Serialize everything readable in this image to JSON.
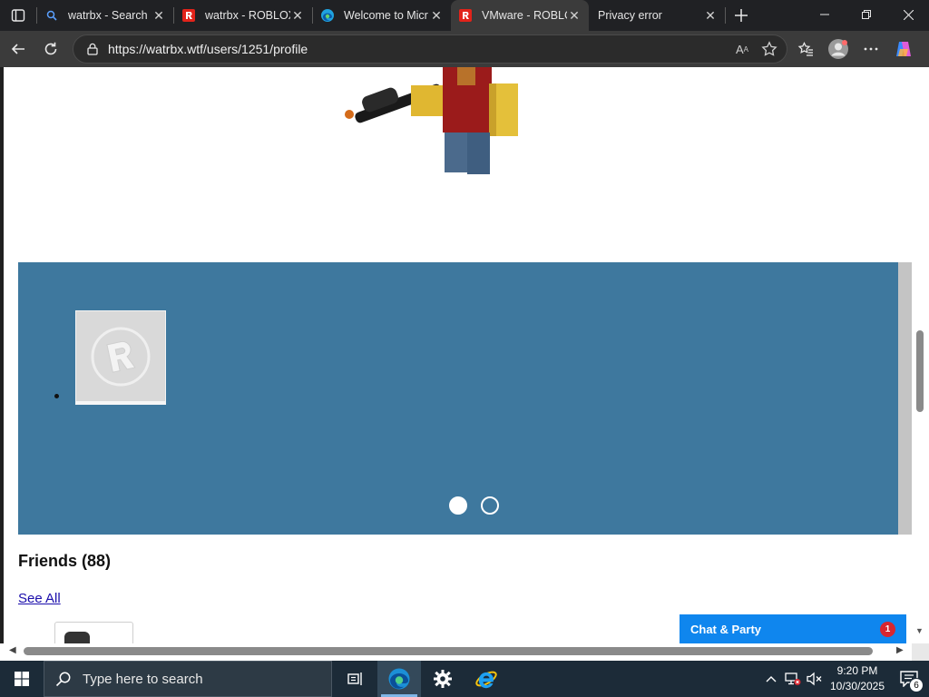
{
  "browser": {
    "tabs": [
      {
        "title": "watrbx - Search",
        "favicon": "search-icon",
        "active": false
      },
      {
        "title": "watrbx - ROBLOX",
        "favicon": "roblox-icon",
        "active": false
      },
      {
        "title": "Welcome to Micr",
        "favicon": "edge-icon",
        "active": false
      },
      {
        "title": "VMware - ROBLC",
        "favicon": "roblox-icon",
        "active": true
      },
      {
        "title": "Privacy error",
        "favicon": "none",
        "active": false
      }
    ],
    "url": "https://watrbx.wtf/users/1251/profile"
  },
  "page": {
    "friends_heading": "Friends (88)",
    "see_all": "See All",
    "carousel": {
      "active_slide": 1,
      "slide_count": 2
    },
    "chat": {
      "label": "Chat & Party",
      "badge": "1"
    }
  },
  "taskbar": {
    "search_placeholder": "Type here to search",
    "time": "9:20 PM",
    "date": "10/30/2025",
    "notifications": "6"
  },
  "colors": {
    "carousel_bg": "#3e789e",
    "chat_bg": "#0f86ee",
    "badge": "#d9262f"
  }
}
